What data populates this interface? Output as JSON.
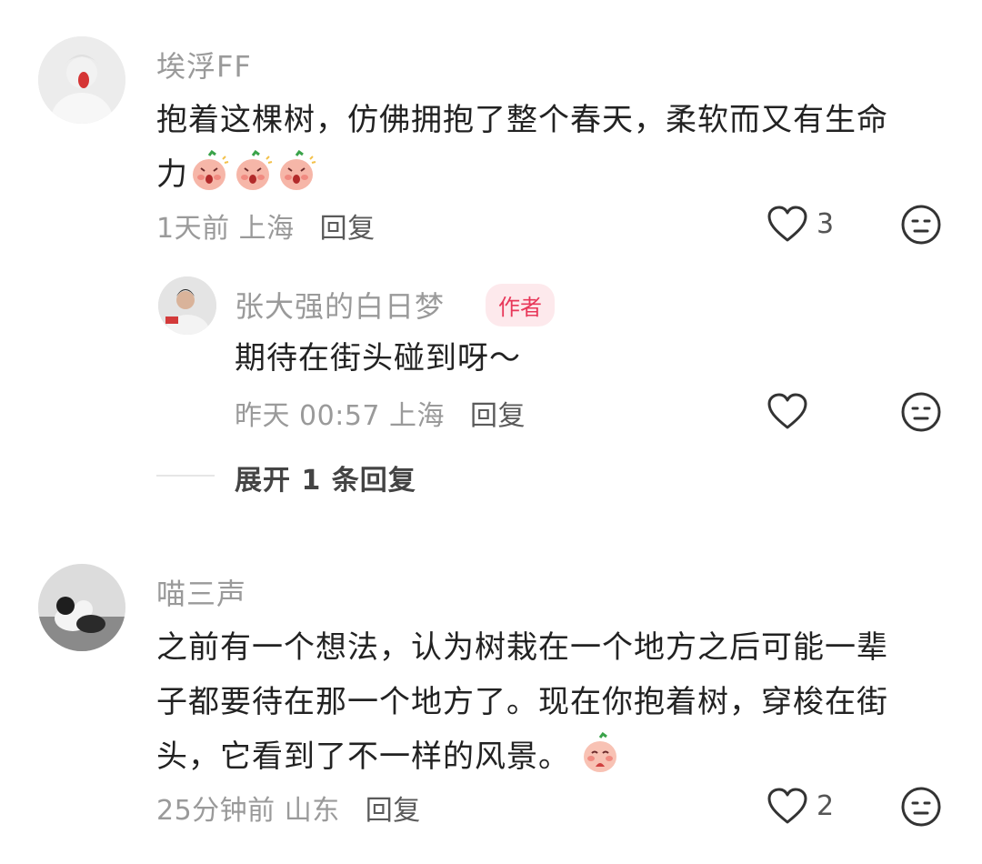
{
  "comments": [
    {
      "username": "埃浮FF",
      "text_line1": "抱着这棵树，仿佛拥抱了整个春天，柔软而又有生命",
      "text_line2": "力",
      "emoji_icon": "peach-shocked-emoji",
      "emoji_count": 3,
      "time_location": "1天前 上海",
      "reply_label": "回复",
      "like_count": "3",
      "replies": [
        {
          "username": "张大强的白日梦",
          "badge": "作者",
          "text": "期待在街头碰到呀～",
          "time_location": "昨天 00:57 上海",
          "reply_label": "回复",
          "like_count": ""
        }
      ],
      "expand_label": "展开 1 条回复"
    },
    {
      "username": "喵三声",
      "text_line1": "之前有一个想法，认为树栽在一个地方之后可能一辈",
      "text_line2": "子都要待在那一个地方了。现在你抱着树，穿梭在街",
      "text_line3": "头，它看到了不一样的风景。",
      "emoji_icon": "peach-shy-emoji",
      "emoji_count": 1,
      "time_location": "25分钟前 山东",
      "reply_label": "回复",
      "like_count": "2"
    }
  ],
  "colors": {
    "username": "#9a9a9a",
    "text": "#222222",
    "badge_bg": "#fde9ec",
    "badge_text": "#e8385a"
  },
  "icons": {
    "like": "heart-outline-icon",
    "dislike": "meh-face-icon"
  }
}
